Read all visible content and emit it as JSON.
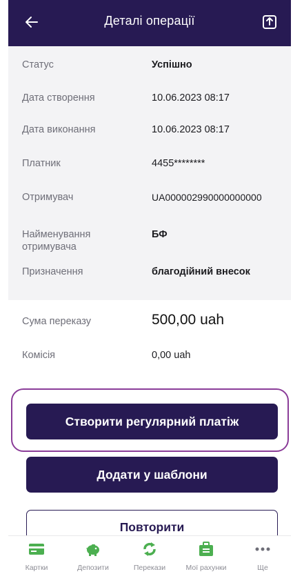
{
  "header": {
    "title": "Деталі операції",
    "back_icon": "arrow-left-icon",
    "share_icon": "share-icon"
  },
  "details": [
    {
      "label": "Статус",
      "value": "Успішно"
    },
    {
      "label": "Дата створення",
      "value": "10.06.2023 08:17"
    },
    {
      "label": "Дата виконання",
      "value": "10.06.2023 08:17"
    },
    {
      "label": "Платник",
      "value": "4455********"
    },
    {
      "label": "Отримувач",
      "value": "UA000002990000000000"
    },
    {
      "label": "Найменування отримувача",
      "value": "БФ"
    },
    {
      "label": "Призначення",
      "value": "благодійний внесок"
    }
  ],
  "summary": {
    "amount_label": "Сума переказу",
    "amount_value": "500,00 uah",
    "fee_label": "Комісія",
    "fee_value": "0,00 uah"
  },
  "actions": {
    "regular_payment": "Створити регулярний платіж",
    "add_template": "Додати у шаблони",
    "repeat": "Повторити"
  },
  "tabbar": [
    {
      "label": "Картки",
      "icon": "card-icon"
    },
    {
      "label": "Депозити",
      "icon": "piggy-bank-icon"
    },
    {
      "label": "Перекази",
      "icon": "transfer-icon"
    },
    {
      "label": "Мої рахунки",
      "icon": "briefcase-icon"
    },
    {
      "label": "Ще",
      "icon": "more-icon"
    }
  ],
  "colors": {
    "header_bg": "#271a53",
    "accent_green": "#4caf50",
    "highlight_border": "#8a3c98"
  }
}
